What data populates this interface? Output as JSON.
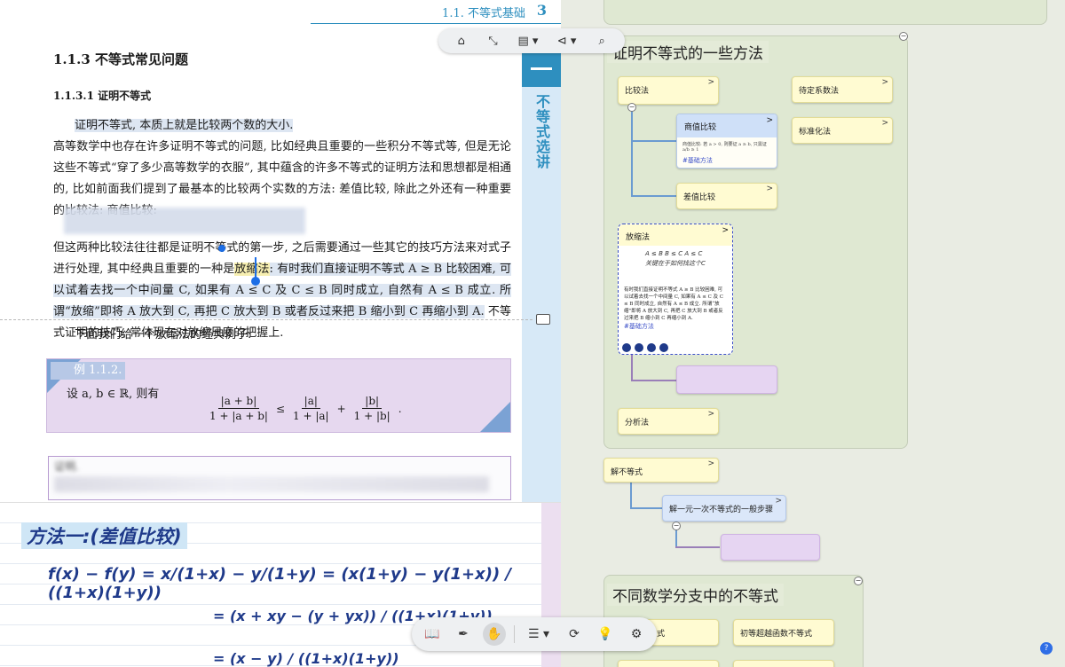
{
  "document": {
    "running_head": "1.1.  不等式基础",
    "page_number": "3",
    "side_tab": "不等式选讲",
    "section_title": "1.1.3   不等式常见问题",
    "subsection_title": "1.1.3.1   证明不等式",
    "para1": "证明不等式, 本质上就是比较两个数的大小.",
    "para2": "高等数学中也存在许多证明不等式的问题, 比如经典且重要的一些积分不等式等, 但是无论这些不等式“穿了多少高等数学的衣服”, 其中蕴含的许多不等式的证明方法和思想都是相通的, 比如前面我们提到了最基本的比较两个实数的方法: 差值比较, 除此之外还有一种重要的比较法: 商值比较:",
    "para3_a": "但这两种比较法往往都是证明不等式的第一步, 之后需要通过一些其它的技巧方法来对式子进行处理, 其中经典且重要的一种是",
    "para3_hl": "放缩法",
    "para3_b": ": 有时我们直接证明不等式 A ≥ B 比较困难, 可以试着去找一个中间量 C, 如果有 A ≤ C 及 C ≤ B 同时成立, 自然有 A ≤ B 成立. 所谓“放缩”即将 A 放大到 C, 再把 C 放大到 B 或者反过来把 B 缩小到 C 再缩小到 A.",
    "para3_c": " 不等式证明的技巧, 常体现在对放缩尺度的把握上.",
    "para4": "下面我们给一个放缩法的经典例子:",
    "example": {
      "tag": "例 1.1.2.",
      "statement": "设 a, b ∈ ℝ, 则有",
      "f1_num": "|a + b|",
      "f1_den": "1 + |a + b|",
      "rel": "≤",
      "f2_num": "|a|",
      "f2_den": "1 + |a|",
      "plus": "+",
      "f3_num": "|b|",
      "f3_den": "1 + |b|",
      "end": "."
    },
    "proof_label": "证明."
  },
  "notes": {
    "title": "方法一:(差值比较)",
    "line1": "f(x) − f(y) = x/(1+x) − y/(1+y) = (x(1+y) − y(1+x)) / ((1+x)(1+y))",
    "line2": "= (x + xy − (y + yx)) / ((1+x)(1+y))",
    "line3": "= (x − y) / ((1+x)(1+y))"
  },
  "top_toolbar": {
    "home": "⌂",
    "collapse": "⤡",
    "page_menu": "▤ ▾",
    "share_menu": "⊲ ▾",
    "search": "⌕"
  },
  "bottom_toolbar": {
    "book": "📖",
    "pen": "✒",
    "hand": "✋",
    "list_menu": "☰ ▾",
    "refresh": "⟳",
    "idea": "💡",
    "settings": "⚙"
  },
  "mindmap": {
    "group1_title": "证明不等式的一些方法",
    "n_compare": "比较法",
    "n_undetermined": "待定系数法",
    "n_standard": "标准化法",
    "n_quotient": "商值比较",
    "n_quotient_body": "商值比较: 若 a > 0, 则要证 a ≥ b, 只需证 a/b ≥ 1",
    "n_quotient_tag": "#基础方法",
    "n_difference": "差值比较",
    "n_squeeze": "放缩法",
    "n_squeeze_sketch": "A ≤ B  B ≤ C  A ≤ C\n关键在于如何找这个C",
    "n_squeeze_body": "有时我们直接证明不等式 A ≥ B 比较困难, 可以试着去找一个中间量 C, 如果有 A ≤ C 及 C ≤ B 同时成立, 自然有 A ≤ B 成立. 所谓“放缩”即将 A 放大到 C, 再把 C 放大到 B 或者反过来把 B 缩小到 C 再缩小到 A.",
    "n_squeeze_tag": "#基础方法",
    "n_analysis": "分析法",
    "n_solve": "解不等式",
    "n_linear_steps": "解一元一次不等式的一般步骤",
    "group2_title": "不同数学分支中的不等式",
    "n_bottom_a": "式",
    "n_elementary": "初等超越函数不等式",
    "chevron": ">",
    "collapse_symbol": "−",
    "help": "?"
  }
}
